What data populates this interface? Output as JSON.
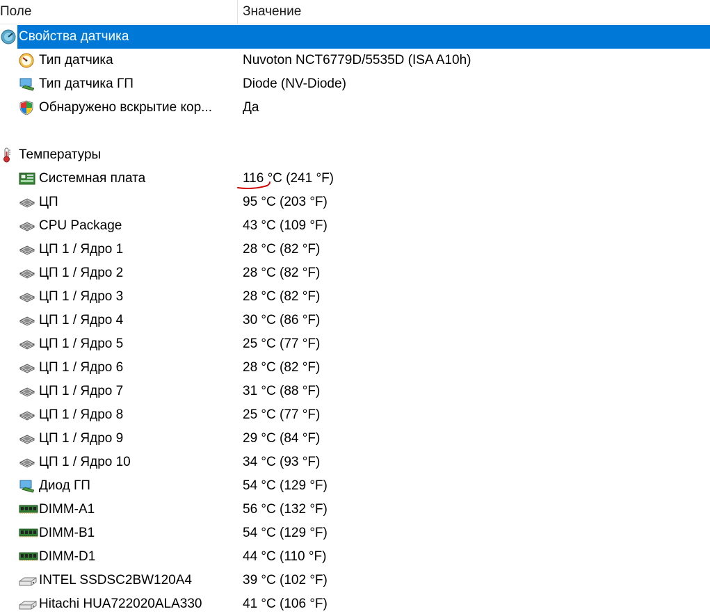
{
  "header": {
    "field_label": "Поле",
    "value_label": "Значение"
  },
  "sensor_group": {
    "label": "Свойства датчика",
    "icon": "sensor-disc-icon",
    "rows": [
      {
        "label": "Тип датчика",
        "value": "Nuvoton NCT6779D/5535D  (ISA A10h)",
        "icon": "gauge-icon"
      },
      {
        "label": "Тип датчика ГП",
        "value": "Diode  (NV-Diode)",
        "icon": "gpu-monitor-icon"
      },
      {
        "label": "Обнаружено вскрытие кор...",
        "value": "Да",
        "icon": "windows-shield-icon"
      }
    ]
  },
  "temps_group": {
    "label": "Температуры",
    "icon": "thermometer-icon",
    "rows": [
      {
        "label": "Системная плата",
        "value": "116 °C  (241 °F)",
        "icon": "motherboard-icon"
      },
      {
        "label": "ЦП",
        "value": "95 °C  (203 °F)",
        "icon": "cpu-chip-icon"
      },
      {
        "label": "CPU Package",
        "value": "43 °C  (109 °F)",
        "icon": "cpu-chip-icon"
      },
      {
        "label": "ЦП 1 / Ядро 1",
        "value": "28 °C  (82 °F)",
        "icon": "cpu-chip-icon"
      },
      {
        "label": "ЦП 1 / Ядро 2",
        "value": "28 °C  (82 °F)",
        "icon": "cpu-chip-icon"
      },
      {
        "label": "ЦП 1 / Ядро 3",
        "value": "28 °C  (82 °F)",
        "icon": "cpu-chip-icon"
      },
      {
        "label": "ЦП 1 / Ядро 4",
        "value": "30 °C  (86 °F)",
        "icon": "cpu-chip-icon"
      },
      {
        "label": "ЦП 1 / Ядро 5",
        "value": "25 °C  (77 °F)",
        "icon": "cpu-chip-icon"
      },
      {
        "label": "ЦП 1 / Ядро 6",
        "value": "28 °C  (82 °F)",
        "icon": "cpu-chip-icon"
      },
      {
        "label": "ЦП 1 / Ядро 7",
        "value": "31 °C  (88 °F)",
        "icon": "cpu-chip-icon"
      },
      {
        "label": "ЦП 1 / Ядро 8",
        "value": "25 °C  (77 °F)",
        "icon": "cpu-chip-icon"
      },
      {
        "label": "ЦП 1 / Ядро 9",
        "value": "29 °C  (84 °F)",
        "icon": "cpu-chip-icon"
      },
      {
        "label": "ЦП 1 / Ядро 10",
        "value": "34 °C  (93 °F)",
        "icon": "cpu-chip-icon"
      },
      {
        "label": "Диод ГП",
        "value": "54 °C  (129 °F)",
        "icon": "gpu-monitor-icon"
      },
      {
        "label": "DIMM-A1",
        "value": "56 °C  (132 °F)",
        "icon": "memory-module-icon"
      },
      {
        "label": "DIMM-B1",
        "value": "54 °C  (129 °F)",
        "icon": "memory-module-icon"
      },
      {
        "label": "DIMM-D1",
        "value": "44 °C  (110 °F)",
        "icon": "memory-module-icon"
      },
      {
        "label": "INTEL SSDSC2BW120A4",
        "value": "39 °C  (102 °F)",
        "icon": "drive-icon"
      },
      {
        "label": "Hitachi HUA722020ALA330",
        "value": "41 °C  (106 °F)",
        "icon": "drive-icon"
      }
    ]
  },
  "colors": {
    "selection": "#0078d7",
    "annotation": "#d40000"
  }
}
